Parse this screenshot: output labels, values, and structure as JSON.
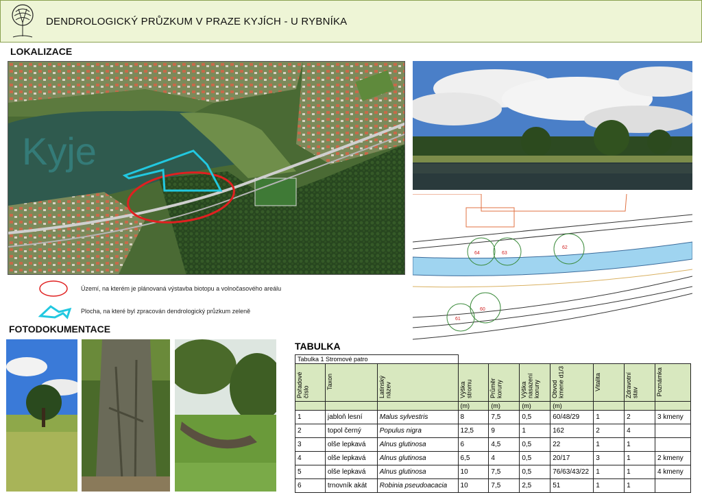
{
  "header": {
    "title": "DENDROLOGICKÝ PRŮZKUM V PRAZE KYJÍCH - U RYBNÍKA"
  },
  "sections": {
    "localization": "LOKALIZACE",
    "photos": "FOTODOKUMENTACE",
    "table": "TABULKA"
  },
  "map": {
    "watermark": "Kyje"
  },
  "legend": [
    {
      "text": "Území, na kterém je plánovaná výstavba biotopu a volnočasového areálu",
      "color": "#e02020"
    },
    {
      "text": "Plocha, na které byl zpracován dendrologický průzkum zeleně",
      "color": "#22c8e0"
    }
  ],
  "plan": {
    "tree_labels": [
      "64",
      "63",
      "62",
      "61",
      "60"
    ]
  },
  "table": {
    "caption": "Tabulka 1 Stromové patro",
    "columns": [
      "Pořadové číslo",
      "Taxon",
      "Latinský název",
      "Výška stromu",
      "Průměr koruny",
      "Výška nasazení koruny",
      "Obvod kmene d1/3",
      "Vitalita",
      "Zdravotní stav",
      "Poznámka"
    ],
    "units": [
      "",
      "",
      "",
      "(m)",
      "(m)",
      "(m)",
      "(m)",
      "",
      "",
      ""
    ],
    "rows": [
      [
        "1",
        "jabloň lesní",
        "Malus sylvestris",
        "8",
        "7,5",
        "0,5",
        "60/48/29",
        "1",
        "2",
        "3 kmeny"
      ],
      [
        "2",
        "topol černý",
        "Populus nigra",
        "12,5",
        "9",
        "1",
        "162",
        "2",
        "4",
        ""
      ],
      [
        "3",
        "olše lepkavá",
        "Alnus glutinosa",
        "6",
        "4,5",
        "0,5",
        "22",
        "1",
        "1",
        ""
      ],
      [
        "4",
        "olše lepkavá",
        "Alnus glutinosa",
        "6,5",
        "4",
        "0,5",
        "20/17",
        "3",
        "1",
        "2 kmeny"
      ],
      [
        "5",
        "olše lepkavá",
        "Alnus glutinosa",
        "10",
        "7,5",
        "0,5",
        "76/63/43/22",
        "1",
        "1",
        "4 kmeny"
      ],
      [
        "6",
        "trnovník akát",
        "Robinia pseudoacacia",
        "10",
        "7,5",
        "2,5",
        "51",
        "1",
        "1",
        ""
      ]
    ]
  }
}
